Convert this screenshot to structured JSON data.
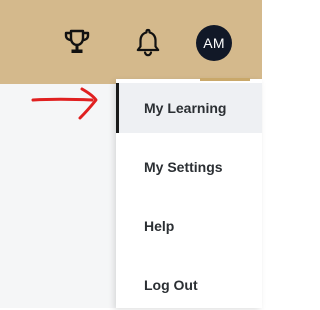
{
  "header": {
    "trophy_icon": "trophy-icon",
    "bell_icon": "bell-icon",
    "avatar_initials": "AM",
    "background_color": "#d4b98c",
    "avatar_color": "#111827"
  },
  "menu": {
    "items": [
      {
        "label": "My Learning",
        "active": true
      },
      {
        "label": "My Settings",
        "active": false
      },
      {
        "label": "Help",
        "active": false
      },
      {
        "label": "Log Out",
        "active": false
      }
    ]
  },
  "annotation": {
    "arrow_icon": "red-arrow-icon",
    "color": "#e02020"
  }
}
